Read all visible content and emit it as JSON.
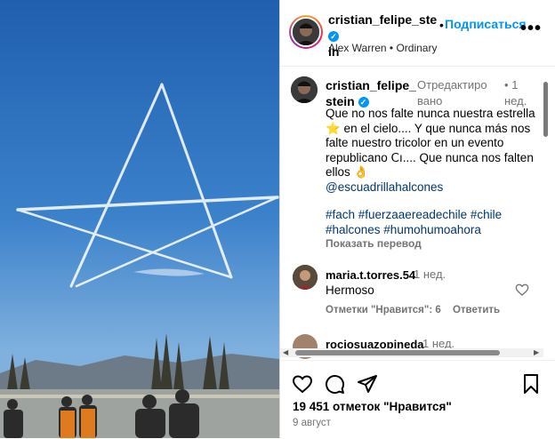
{
  "header": {
    "username_line1": "cristian_felipe_ste",
    "username_line2": "in",
    "dot": "•",
    "follow_label": "Подписаться",
    "more_label": "•••",
    "audio": "Alex Warren • Ordinary"
  },
  "caption": {
    "username_line1": "cristian_felipe_",
    "username_line2": "stein",
    "edited_line1": "Отредактиро",
    "edited_line2": "вано",
    "dot": "•",
    "time_line1": "1",
    "time_line2": "нед.",
    "line1": "Que no nos falte nunca nuestra estrella",
    "line2": "⭐ en el cielo.... Y que nunca más nos",
    "line3": "falte nuestro tricolor en un evento",
    "line4": "republicano ꓚı.... Que nunca nos falten",
    "line5": "ellos 👌",
    "mention": "@escuadrillahalcones",
    "tags_line1": "#fach #fuerzaaereadechile #chile",
    "tags_line2": "#halcones #humohumoahora",
    "show_translation": "Показать перевод"
  },
  "comments": [
    {
      "username": "maria.t.torres.54",
      "time": "1 нед.",
      "text": "Hermoso",
      "likes_label": "Отметки \"Нравится\": 6",
      "reply_label": "Ответить"
    },
    {
      "username": "rociosuazopineda_",
      "time": "1 нед."
    }
  ],
  "actions": {
    "icons": [
      "heart-icon",
      "comment-icon",
      "share-icon",
      "bookmark-icon"
    ]
  },
  "likes_text": "19 451 отметок \"Нравится\"",
  "date": "9 август",
  "colors": {
    "accent": "#0095f6",
    "link": "#00376b",
    "muted": "#737373"
  }
}
